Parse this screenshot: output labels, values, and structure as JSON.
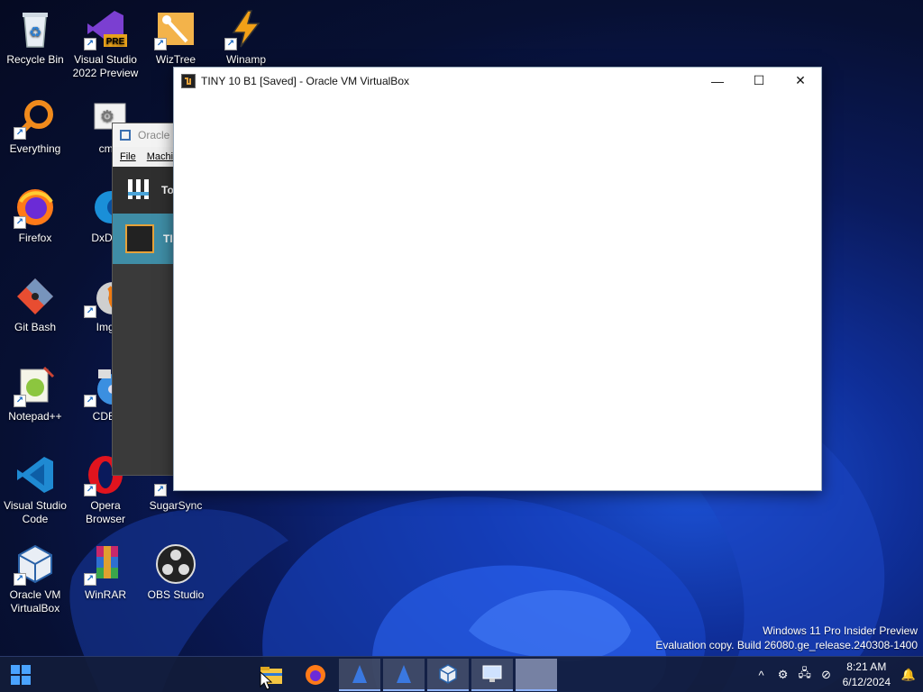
{
  "desktop": {
    "icons": [
      {
        "label": "Recycle Bin",
        "icon": "recycle-bin-icon"
      },
      {
        "label": "Visual Studio 2022 Preview",
        "icon": "visual-studio-icon",
        "badge": "PRE"
      },
      {
        "label": "WizTree",
        "icon": "wiztree-icon"
      },
      {
        "label": "Winamp",
        "icon": "winamp-icon"
      },
      {
        "label": "Everything",
        "icon": "everything-icon"
      },
      {
        "label": "cmd.b",
        "icon": "cmd-icon"
      },
      {
        "label": "Firefox",
        "icon": "firefox-icon"
      },
      {
        "label": "DxDiag",
        "icon": "dxdiag-icon"
      },
      {
        "label": "Git Bash",
        "icon": "git-bash-icon"
      },
      {
        "label": "ImgBu",
        "icon": "imgburn-icon"
      },
      {
        "label": "Notepad++",
        "icon": "notepadpp-icon"
      },
      {
        "label": "CDBurn",
        "icon": "cdburner-icon"
      },
      {
        "label": "Visual Studio Code",
        "icon": "vscode-icon"
      },
      {
        "label": "Opera Browser",
        "icon": "opera-icon"
      },
      {
        "label": "SugarSync",
        "icon": "sugarsync-icon"
      },
      {
        "label": "Oracle VM VirtualBox",
        "icon": "virtualbox-icon"
      },
      {
        "label": "WinRAR",
        "icon": "winrar-icon"
      },
      {
        "label": "OBS Studio",
        "icon": "obs-icon"
      }
    ]
  },
  "bg_window": {
    "title": "Oracle",
    "menu": [
      "File",
      "Machi"
    ],
    "tools_label": "To",
    "vm_label": "TI"
  },
  "vm_window": {
    "title": "TINY 10 B1 [Saved] - Oracle VM VirtualBox",
    "minimize": "—",
    "maximize": "☐",
    "close": "✕"
  },
  "watermark": {
    "line1": "Windows 11 Pro Insider Preview",
    "line2": "Evaluation copy. Build 26080.ge_release.240308-1400"
  },
  "taskbar": {
    "items": [
      "start-button",
      "file-explorer",
      "firefox",
      "vm-app-1",
      "vm-app-2",
      "virtualbox",
      "remote-desktop",
      "active-window"
    ],
    "tray": {
      "chevron": "^",
      "time": "8:21 AM",
      "date": "6/12/2024"
    }
  },
  "colors": {
    "accent": "#1c52d6",
    "taskbar": "#121c3a",
    "selected_vm": "#3f8da6"
  }
}
